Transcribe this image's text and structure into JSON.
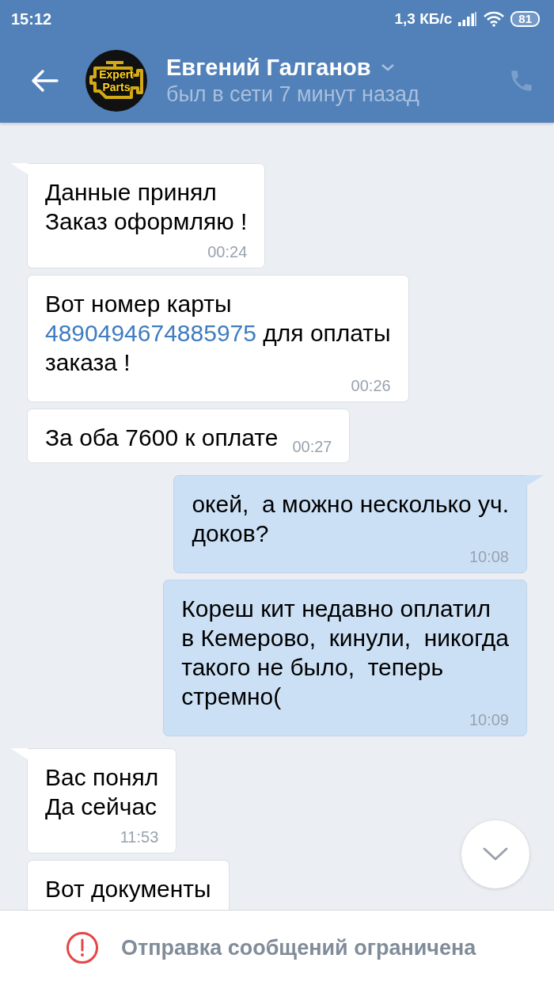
{
  "status_bar": {
    "time": "15:12",
    "speed": "1,3 КБ/с",
    "battery": "81"
  },
  "header": {
    "avatar": {
      "lines": [
        "Expert",
        "Parts"
      ]
    },
    "name": "Евгений Галганов",
    "status": "был в сети 7 минут назад"
  },
  "messages": [
    {
      "kind": "incoming",
      "tail": true,
      "lines": [
        [
          {
            "kind": "text",
            "text": "Данные принял"
          }
        ],
        [
          {
            "kind": "text",
            "text": "Заказ оформляю !"
          }
        ]
      ],
      "time": "00:24"
    },
    {
      "kind": "incoming",
      "tail": false,
      "lines": [
        [
          {
            "kind": "text",
            "text": "Вот номер карты"
          }
        ],
        [
          {
            "kind": "link",
            "text": "4890494674885975"
          },
          {
            "kind": "text",
            "text": " для оплаты"
          }
        ],
        [
          {
            "kind": "text",
            "text": "заказа !"
          }
        ]
      ],
      "time": "00:26"
    },
    {
      "kind": "incoming",
      "tail": false,
      "lines": [
        [
          {
            "kind": "text",
            "text": "За оба 7600 к оплате"
          }
        ]
      ],
      "time": "00:27"
    },
    {
      "kind": "outgoing",
      "tail": true,
      "lines": [
        [
          {
            "kind": "text",
            "text": "окей,  а можно несколько уч."
          }
        ],
        [
          {
            "kind": "text",
            "text": "доков?"
          }
        ]
      ],
      "time": "10:08"
    },
    {
      "kind": "outgoing",
      "tail": false,
      "lines": [
        [
          {
            "kind": "text",
            "text": "Кореш кит недавно оплатил"
          }
        ],
        [
          {
            "kind": "text",
            "text": "в Кемерово,  кинули,  никогда"
          }
        ],
        [
          {
            "kind": "text",
            "text": "такого не было,  теперь"
          }
        ],
        [
          {
            "kind": "text",
            "text": "стремно("
          }
        ]
      ],
      "time": "10:09"
    },
    {
      "kind": "incoming",
      "tail": true,
      "lines": [
        [
          {
            "kind": "text",
            "text": "Вас понял"
          }
        ],
        [
          {
            "kind": "text",
            "text": "Да сейчас"
          }
        ]
      ],
      "time": "11:53"
    },
    {
      "kind": "incoming",
      "tail": false,
      "lines": [
        [
          {
            "kind": "text",
            "text": "Вот документы"
          }
        ]
      ]
    }
  ],
  "notice": {
    "text": "Отправка сообщений ограничена"
  }
}
